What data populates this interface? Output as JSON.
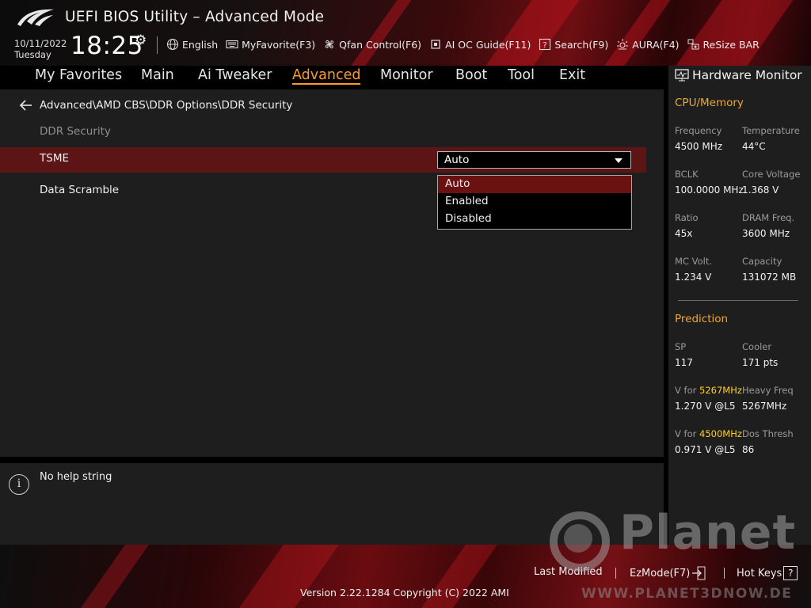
{
  "header": {
    "title": "UEFI BIOS Utility – Advanced Mode",
    "date": "10/11/2022",
    "day": "Tuesday",
    "time": "18:25",
    "toolbar": [
      {
        "label": "English",
        "icon": "globe-icon"
      },
      {
        "label": "MyFavorite(F3)",
        "icon": "keyboard-icon"
      },
      {
        "label": "Qfan Control(F6)",
        "icon": "fan-icon"
      },
      {
        "label": "AI OC Guide(F11)",
        "icon": "chip-icon"
      },
      {
        "label": "Search(F9)",
        "icon": "question-box-icon"
      },
      {
        "label": "AURA(F4)",
        "icon": "light-icon"
      },
      {
        "label": "ReSize BAR",
        "icon": "resize-bar-icon"
      }
    ]
  },
  "nav": {
    "tabs": [
      "My Favorites",
      "Main",
      "Ai Tweaker",
      "Advanced",
      "Monitor",
      "Boot",
      "Tool",
      "Exit"
    ],
    "active": "Advanced"
  },
  "main": {
    "breadcrumb": "Advanced\\AMD CBS\\DDR Options\\DDR Security",
    "section_title": "DDR Security",
    "settings": [
      {
        "label": "TSME",
        "value": "Auto"
      },
      {
        "label": "Data Scramble"
      }
    ],
    "dropdown_options": [
      "Auto",
      "Enabled",
      "Disabled"
    ],
    "dropdown_selected": "Auto"
  },
  "help": {
    "text": "No help string"
  },
  "monitor": {
    "title": "Hardware Monitor",
    "cpu_memory": {
      "heading": "CPU/Memory",
      "items": [
        {
          "label": "Frequency",
          "value": "4500 MHz"
        },
        {
          "label": "Temperature",
          "value": "44°C"
        },
        {
          "label": "BCLK",
          "value": "100.0000 MHz"
        },
        {
          "label": "Core Voltage",
          "value": "1.368 V"
        },
        {
          "label": "Ratio",
          "value": "45x"
        },
        {
          "label": "DRAM Freq.",
          "value": "3600 MHz"
        },
        {
          "label": "MC Volt.",
          "value": "1.234 V"
        },
        {
          "label": "Capacity",
          "value": "131072 MB"
        }
      ]
    },
    "prediction": {
      "heading": "Prediction",
      "items": [
        {
          "label": "SP",
          "value": "117"
        },
        {
          "label": "Cooler",
          "value": "171 pts"
        },
        {
          "label_prefix": "V for ",
          "label_highlight": "5267MHz",
          "value": "1.270 V @L5"
        },
        {
          "label": "Heavy Freq",
          "value": "5267MHz"
        },
        {
          "label_prefix": "V for ",
          "label_highlight": "4500MHz",
          "value": "0.971 V @L5"
        },
        {
          "label": "Dos Thresh",
          "value": "86"
        }
      ]
    }
  },
  "footer": {
    "last_modified": "Last Modified",
    "ezmode": "EzMode(F7)",
    "hotkeys": "Hot Keys",
    "hotkeys_key": "?",
    "version": "Version 2.22.1284 Copyright (C) 2022 AMI"
  },
  "watermark": {
    "brand": "Planet",
    "url": "WWW.PLANET3DNOW.DE"
  },
  "colors": {
    "accent": "#ff9a2a",
    "section_heading": "#f0a830",
    "highlight": "#ffd020",
    "selected_row": "#5d1414"
  }
}
